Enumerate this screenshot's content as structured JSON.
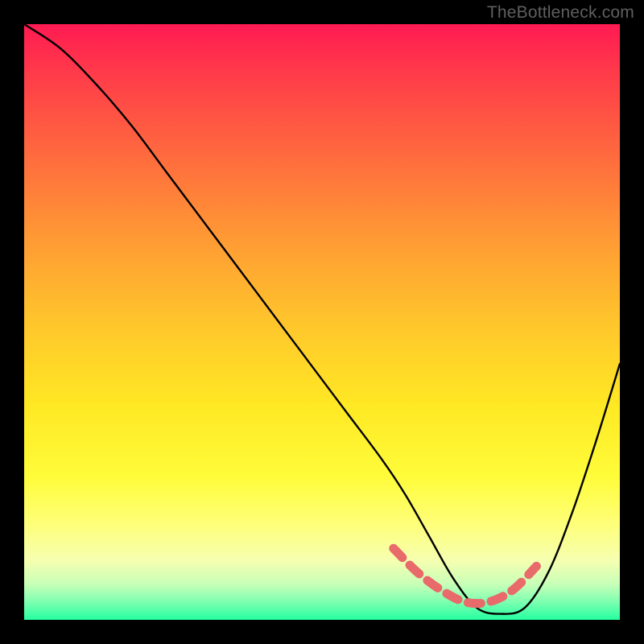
{
  "watermark": "TheBottleneck.com",
  "chart_data": {
    "type": "line",
    "title": "",
    "xlabel": "",
    "ylabel": "",
    "xlim": [
      0,
      100
    ],
    "ylim": [
      0,
      100
    ],
    "grid": false,
    "legend": null,
    "series": [
      {
        "name": "bottleneck-curve",
        "x": [
          0,
          6,
          12,
          18,
          24,
          30,
          36,
          42,
          48,
          54,
          60,
          64,
          68,
          72,
          76,
          80,
          84,
          88,
          92,
          96,
          100
        ],
        "y": [
          100,
          96,
          90,
          83,
          75,
          67,
          59,
          51,
          43,
          35,
          27,
          21,
          14,
          7,
          2,
          1,
          2,
          8,
          18,
          30,
          43
        ],
        "color": "#000000"
      },
      {
        "name": "optimal-segment",
        "x": [
          62,
          66,
          70,
          74,
          78,
          82,
          86
        ],
        "y": [
          12,
          8,
          5,
          3,
          3,
          5,
          9
        ],
        "color": "#e86a6a",
        "style": "dashed-thick"
      }
    ],
    "gradient_stops": [
      {
        "pos": 0.0,
        "color": "#ff1a52"
      },
      {
        "pos": 0.22,
        "color": "#ff6a3e"
      },
      {
        "pos": 0.5,
        "color": "#ffc52c"
      },
      {
        "pos": 0.76,
        "color": "#fffc3a"
      },
      {
        "pos": 0.94,
        "color": "#c8ffb8"
      },
      {
        "pos": 1.0,
        "color": "#25ffa0"
      }
    ]
  }
}
